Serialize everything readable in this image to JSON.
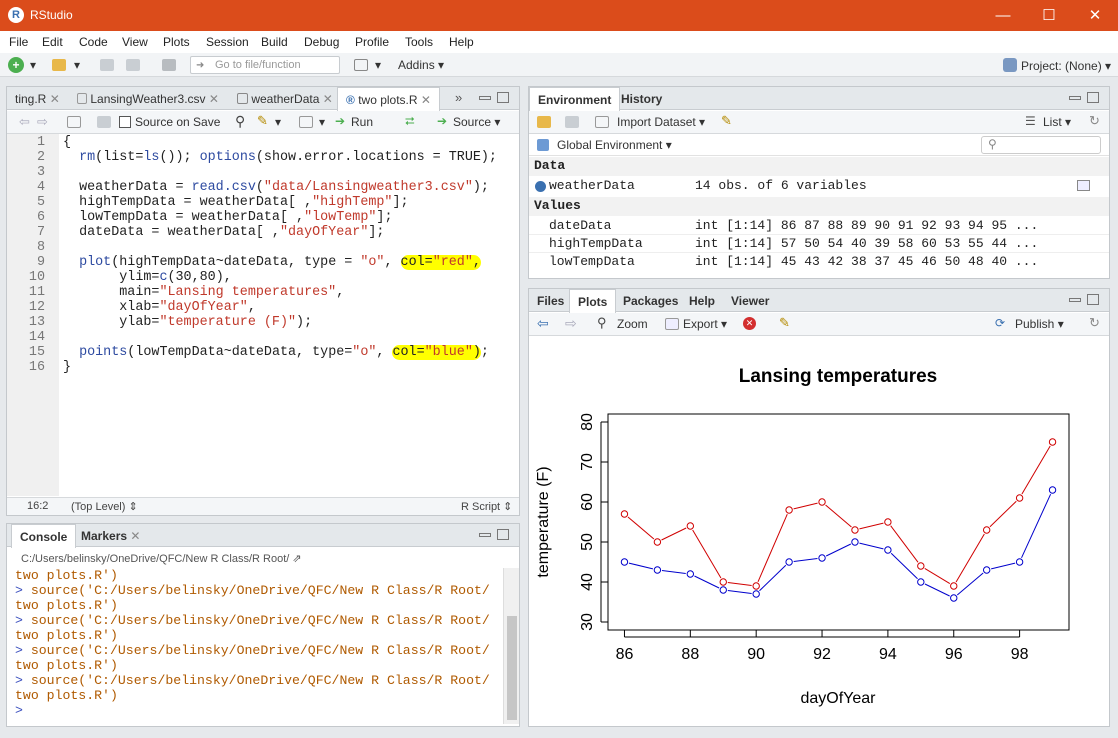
{
  "window": {
    "title": "RStudio",
    "minimize": "—",
    "maximize": "☐",
    "close": "✕"
  },
  "menu": [
    "File",
    "Edit",
    "Code",
    "View",
    "Plots",
    "Session",
    "Build",
    "Debug",
    "Profile",
    "Tools",
    "Help"
  ],
  "toolbar": {
    "goto_placeholder": "Go to file/function",
    "addins": "Addins",
    "project": "Project: (None)"
  },
  "editor": {
    "tabs": [
      "ting.R",
      "LansingWeather3.csv",
      "weatherData",
      "two plots.R"
    ],
    "active_tab": "two plots.R",
    "source_on_save": "Source on Save",
    "run": "Run",
    "source": "Source",
    "line_numbers": [
      "1",
      "2",
      "3",
      "4",
      "5",
      "6",
      "7",
      "8",
      "9",
      "10",
      "11",
      "12",
      "13",
      "14",
      "15",
      "16"
    ],
    "lines": [
      "{",
      "  rm(list=ls()); options(show.error.locations = TRUE);",
      "",
      "  weatherData = read.csv(\"data/Lansingweather3.csv\");",
      "  highTempData = weatherData[ ,\"highTemp\"];",
      "  lowTempData = weatherData[ ,\"lowTemp\"];",
      "  dateData = weatherData[ ,\"dayOfYear\"];",
      "",
      "  plot(highTempData~dateData, type = \"o\", col=\"red\",",
      "       ylim=c(30,80),",
      "       main=\"Lansing temperatures\",",
      "       xlab=\"dayOfYear\",",
      "       ylab=\"temperature (F)\");",
      "",
      "  points(lowTempData~dateData, type=\"o\", col=\"blue\");",
      "}"
    ],
    "cursor_pos": "16:2",
    "scope": "(Top Level)",
    "filetype": "R Script"
  },
  "console": {
    "tabs": [
      "Console",
      "Markers"
    ],
    "path": "C:/Users/belinsky/OneDrive/QFC/New R Class/R Root/",
    "lines": [
      "two plots.R')",
      "> source('C:/Users/belinsky/OneDrive/QFC/New R Class/R Root/",
      "two plots.R')",
      "> source('C:/Users/belinsky/OneDrive/QFC/New R Class/R Root/",
      "two plots.R')",
      "> source('C:/Users/belinsky/OneDrive/QFC/New R Class/R Root/",
      "two plots.R')",
      "> source('C:/Users/belinsky/OneDrive/QFC/New R Class/R Root/",
      "two plots.R')",
      "> "
    ]
  },
  "environment": {
    "tabs": [
      "Environment",
      "History"
    ],
    "import": "Import Dataset",
    "list": "List",
    "scope": "Global Environment",
    "data_header": "Data",
    "values_header": "Values",
    "data": [
      {
        "name": "weatherData",
        "value": "14 obs. of 6 variables"
      }
    ],
    "values": [
      {
        "name": "dateData",
        "value": "int [1:14] 86 87 88 89 90 91 92 93 94 95 ..."
      },
      {
        "name": "highTempData",
        "value": "int [1:14] 57 50 54 40 39 58 60 53 55 44 ..."
      },
      {
        "name": "lowTempData",
        "value": "int [1:14] 45 43 42 38 37 45 46 50 48 40 ..."
      }
    ]
  },
  "files": {
    "tabs": [
      "Files",
      "Plots",
      "Packages",
      "Help",
      "Viewer"
    ],
    "active_tab": "Plots",
    "zoom": "Zoom",
    "export": "Export",
    "publish": "Publish"
  },
  "chart_data": {
    "type": "line",
    "title": "Lansing temperatures",
    "xlabel": "dayOfYear",
    "ylabel": "temperature (F)",
    "x": [
      86,
      87,
      88,
      89,
      90,
      91,
      92,
      93,
      94,
      95,
      96,
      97,
      98,
      99
    ],
    "series": [
      {
        "color": "#d00000",
        "values": [
          57,
          50,
          54,
          40,
          39,
          58,
          60,
          53,
          55,
          44,
          39,
          53,
          61,
          75
        ]
      },
      {
        "color": "#0000cc",
        "values": [
          45,
          43,
          42,
          38,
          37,
          45,
          46,
          50,
          48,
          40,
          36,
          43,
          45,
          63
        ]
      }
    ],
    "xticks": [
      "86",
      "88",
      "90",
      "92",
      "94",
      "96",
      "98"
    ],
    "yticks": [
      "30",
      "40",
      "50",
      "60",
      "70",
      "80"
    ],
    "xlim": [
      85.5,
      99.5
    ],
    "ylim": [
      28,
      82
    ]
  }
}
